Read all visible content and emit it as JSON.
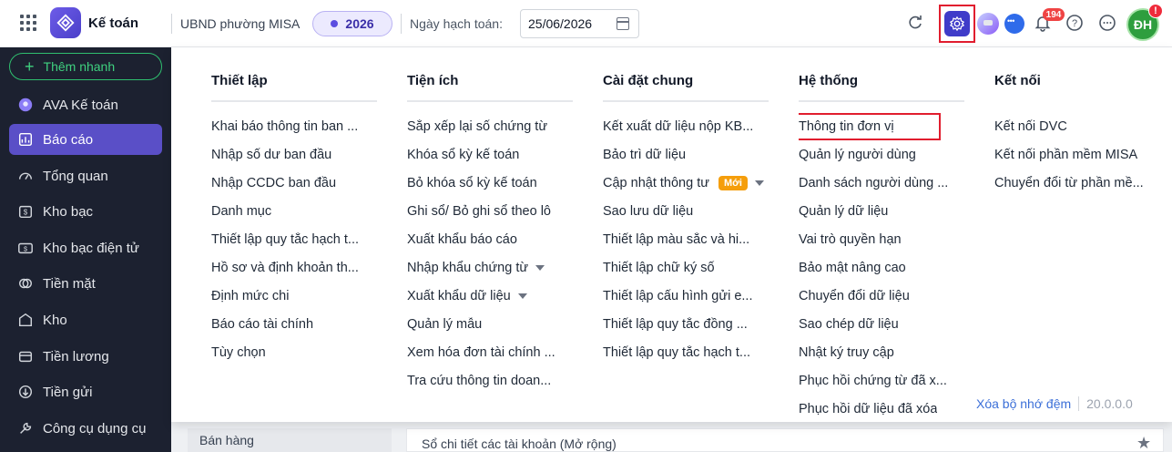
{
  "header": {
    "app_title": "Kế toán",
    "unit_name": "UBND phường MISA",
    "year": "2026",
    "date_label": "Ngày hạch toán:",
    "date_value": "25/06/2026",
    "notification_count": "194",
    "avatar_initials": "ĐH",
    "avatar_alert": "!"
  },
  "sidebar": {
    "quick_add_label": "Thêm nhanh",
    "items": [
      {
        "label": "AVA Kế toán",
        "icon": "ava-icon"
      },
      {
        "label": "Báo cáo",
        "icon": "report-icon",
        "active": true
      },
      {
        "label": "Tổng quan",
        "icon": "overview-icon"
      },
      {
        "label": "Kho bạc",
        "icon": "treasury-icon"
      },
      {
        "label": "Kho bạc điện tử",
        "icon": "e-treasury-icon"
      },
      {
        "label": "Tiền mặt",
        "icon": "cash-icon"
      },
      {
        "label": "Kho",
        "icon": "warehouse-icon"
      },
      {
        "label": "Tiền lương",
        "icon": "salary-icon"
      },
      {
        "label": "Tiền gửi",
        "icon": "deposit-icon"
      },
      {
        "label": "Công cụ dụng cụ",
        "icon": "tools-icon"
      }
    ]
  },
  "background": {
    "left_item": "Bán hàng",
    "right_item": "Sổ chi tiết các tài khoản (Mở rộng)"
  },
  "settings_menu": {
    "columns": [
      {
        "title": "Thiết lập",
        "items": [
          {
            "label": "Khai báo thông tin ban ..."
          },
          {
            "label": "Nhập số dư ban đầu"
          },
          {
            "label": "Nhập CCDC ban đầu"
          },
          {
            "label": "Danh mục"
          },
          {
            "label": "Thiết lập quy tắc hạch t..."
          },
          {
            "label": "Hồ sơ và định khoản th..."
          },
          {
            "label": "Định mức chi"
          },
          {
            "label": "Báo cáo tài chính"
          },
          {
            "label": "Tùy chọn"
          }
        ]
      },
      {
        "title": "Tiện ích",
        "items": [
          {
            "label": "Sắp xếp lại số chứng từ"
          },
          {
            "label": "Khóa sổ kỳ kế toán"
          },
          {
            "label": "Bỏ khóa sổ kỳ kế toán"
          },
          {
            "label": "Ghi sổ/ Bỏ ghi sổ theo lô"
          },
          {
            "label": "Xuất khẩu báo cáo"
          },
          {
            "label": "Nhập khẩu chứng từ",
            "caret": true
          },
          {
            "label": "Xuất khẩu dữ liệu",
            "caret": true
          },
          {
            "label": "Quản lý mẫu"
          },
          {
            "label": "Xem hóa đơn tài chính ..."
          },
          {
            "label": "Tra cứu thông tin doan..."
          }
        ]
      },
      {
        "title": "Cài đặt chung",
        "items": [
          {
            "label": "Kết xuất dữ liệu nộp KB..."
          },
          {
            "label": "Bảo trì dữ liệu"
          },
          {
            "label": "Cập nhật thông tư",
            "badge": "Mới",
            "caret": true
          },
          {
            "label": "Sao lưu dữ liệu"
          },
          {
            "label": "Thiết lập màu sắc và hi..."
          },
          {
            "label": "Thiết lập chữ ký số"
          },
          {
            "label": "Thiết lập cấu hình gửi e..."
          },
          {
            "label": "Thiết lập quy tắc đồng ..."
          },
          {
            "label": "Thiết lập quy tắc hạch t..."
          }
        ]
      },
      {
        "title": "Hệ thống",
        "items": [
          {
            "label": "Thông tin đơn vị",
            "highlighted": true
          },
          {
            "label": "Quản lý người dùng"
          },
          {
            "label": "Danh sách người dùng ..."
          },
          {
            "label": "Quản lý dữ liệu"
          },
          {
            "label": "Vai trò quyền hạn"
          },
          {
            "label": "Bảo mật nâng cao"
          },
          {
            "label": "Chuyển đổi dữ liệu"
          },
          {
            "label": "Sao chép dữ liệu"
          },
          {
            "label": "Nhật ký truy cập"
          },
          {
            "label": "Phục hồi chứng từ đã x..."
          },
          {
            "label": "Phục hồi dữ liệu đã xóa"
          }
        ]
      },
      {
        "title": "Kết nối",
        "items": [
          {
            "label": "Kết nối DVC"
          },
          {
            "label": "Kết nối phần mềm MISA"
          },
          {
            "label": "Chuyển đổi từ phần mề..."
          }
        ]
      }
    ],
    "clear_cache_label": "Xóa bộ nhớ đệm",
    "version": "20.0.0.0"
  },
  "colors": {
    "accent": "#5a4fc7",
    "sidebar_bg": "#1c2130",
    "highlight_border": "#e11d2e",
    "new_badge": "#f59e0b",
    "link": "#3b6fd8"
  }
}
